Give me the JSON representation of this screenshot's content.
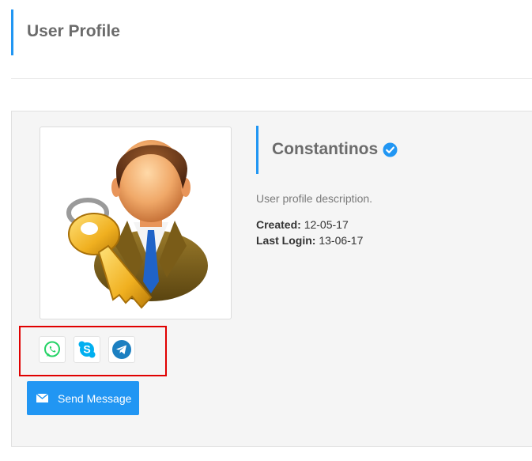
{
  "page": {
    "title": "User Profile"
  },
  "profile": {
    "name": "Constantinos",
    "verified": true,
    "description": "User profile description.",
    "created_label": "Created:",
    "created_value": "12-05-17",
    "last_login_label": "Last Login:",
    "last_login_value": "13-06-17",
    "avatar_icon": "user-key-icon"
  },
  "social": {
    "items": [
      {
        "name": "whatsapp",
        "icon": "whatsapp-icon",
        "color": "#25d366"
      },
      {
        "name": "skype",
        "icon": "skype-icon",
        "color": "#00aff0"
      },
      {
        "name": "telegram",
        "icon": "telegram-icon",
        "color": "#0088cc"
      }
    ]
  },
  "actions": {
    "send_message_label": "Send Message",
    "send_message_icon": "envelope-icon"
  },
  "colors": {
    "accent": "#2196f3",
    "highlight": "#e00000",
    "verified": "#2196f3"
  }
}
